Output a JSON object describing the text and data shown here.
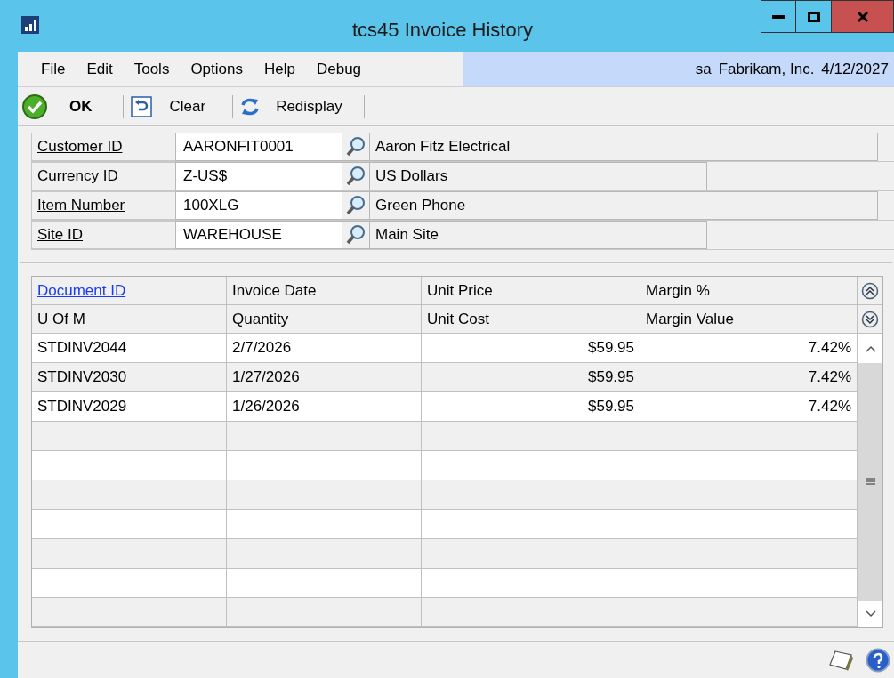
{
  "window": {
    "title": "tcs45 Invoice History"
  },
  "menu": [
    "File",
    "Edit",
    "Tools",
    "Options",
    "Help",
    "Debug"
  ],
  "status": {
    "user": "sa",
    "company": "Fabrikam, Inc.",
    "date": "4/12/2027"
  },
  "toolbar": [
    {
      "kind": "ok",
      "label": "OK"
    },
    {
      "kind": "clear",
      "label": "Clear"
    },
    {
      "kind": "redisplay",
      "label": "Redisplay"
    }
  ],
  "fields": [
    {
      "label": "Customer ID",
      "value": "AARONFIT0001",
      "description": "Aaron Fitz Electrical"
    },
    {
      "label": "Currency ID",
      "value": "Z-US$",
      "description": "US Dollars"
    },
    {
      "label": "Item Number",
      "value": "100XLG",
      "description": "Green Phone"
    },
    {
      "label": "Site ID",
      "value": "WAREHOUSE",
      "description": "Main Site"
    }
  ],
  "grid": {
    "header_1": [
      "Document ID",
      "Invoice Date",
      "Unit Price",
      "Margin %"
    ],
    "header_2": [
      "U Of M",
      "Quantity",
      "Unit Cost",
      "Margin Value"
    ],
    "rows": [
      [
        "STDINV2044",
        "2/7/2026",
        "$59.95",
        "7.42%"
      ],
      [
        "STDINV2030",
        "1/27/2026",
        "$59.95",
        "7.42%"
      ],
      [
        "STDINV2029",
        "1/26/2026",
        "$59.95",
        "7.42%"
      ]
    ]
  }
}
